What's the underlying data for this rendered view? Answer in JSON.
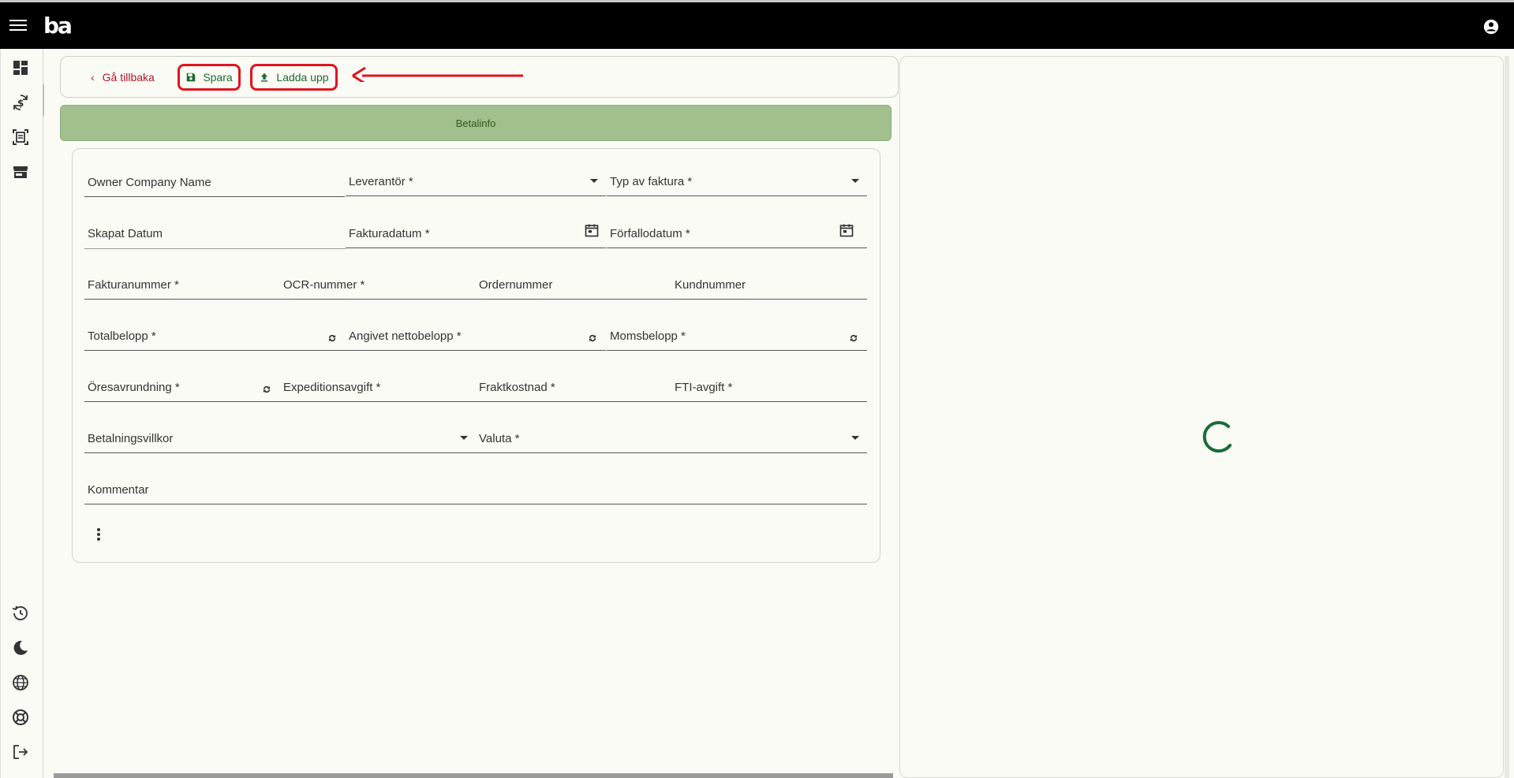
{
  "app": {
    "logo_text": "ba"
  },
  "icons": {
    "menu": "hamburger-icon",
    "account": "account-circle-icon",
    "rail": [
      "dashboard-icon",
      "currency-exchange-icon",
      "document-scan-icon",
      "store-icon",
      "history-icon",
      "dark-mode-icon",
      "globe-icon",
      "support-icon",
      "logout-icon"
    ]
  },
  "actions": {
    "back_label": "Gå tillbaka",
    "save_label": "Spara",
    "upload_label": "Ladda upp"
  },
  "tabs": {
    "active_label": "Betalinfo"
  },
  "form": {
    "owner_company_name": "Owner Company Name",
    "leverantor": "Leverantör *",
    "typ_av_faktura": "Typ av faktura *",
    "skapat_datum": "Skapat Datum",
    "fakturadatum": "Fakturadatum *",
    "forfallodatum": "Förfallodatum *",
    "fakturanummer": "Fakturanummer *",
    "ocr_nummer": "OCR-nummer *",
    "ordernummer": "Ordernummer",
    "kundnummer": "Kundnummer",
    "totalbelopp": "Totalbelopp *",
    "angivet_nettobelopp": "Angivet nettobelopp *",
    "momsbelopp": "Momsbelopp *",
    "oresavrundning": "Öresavrundning *",
    "expeditionsavgift": "Expeditionsavgift *",
    "fraktkostnad": "Fraktkostnad *",
    "fti_avgift": "FTI-avgift *",
    "betalningsvillkor": "Betalningsvillkor",
    "valuta": "Valuta *",
    "kommentar": "Kommentar"
  },
  "colors": {
    "topbar": "#000000",
    "accent_red": "#b2142b",
    "accent_green": "#1a6b2d",
    "tab_bg": "#a1c08e",
    "highlight": "#e0141e",
    "spinner": "#1a6b3a"
  }
}
